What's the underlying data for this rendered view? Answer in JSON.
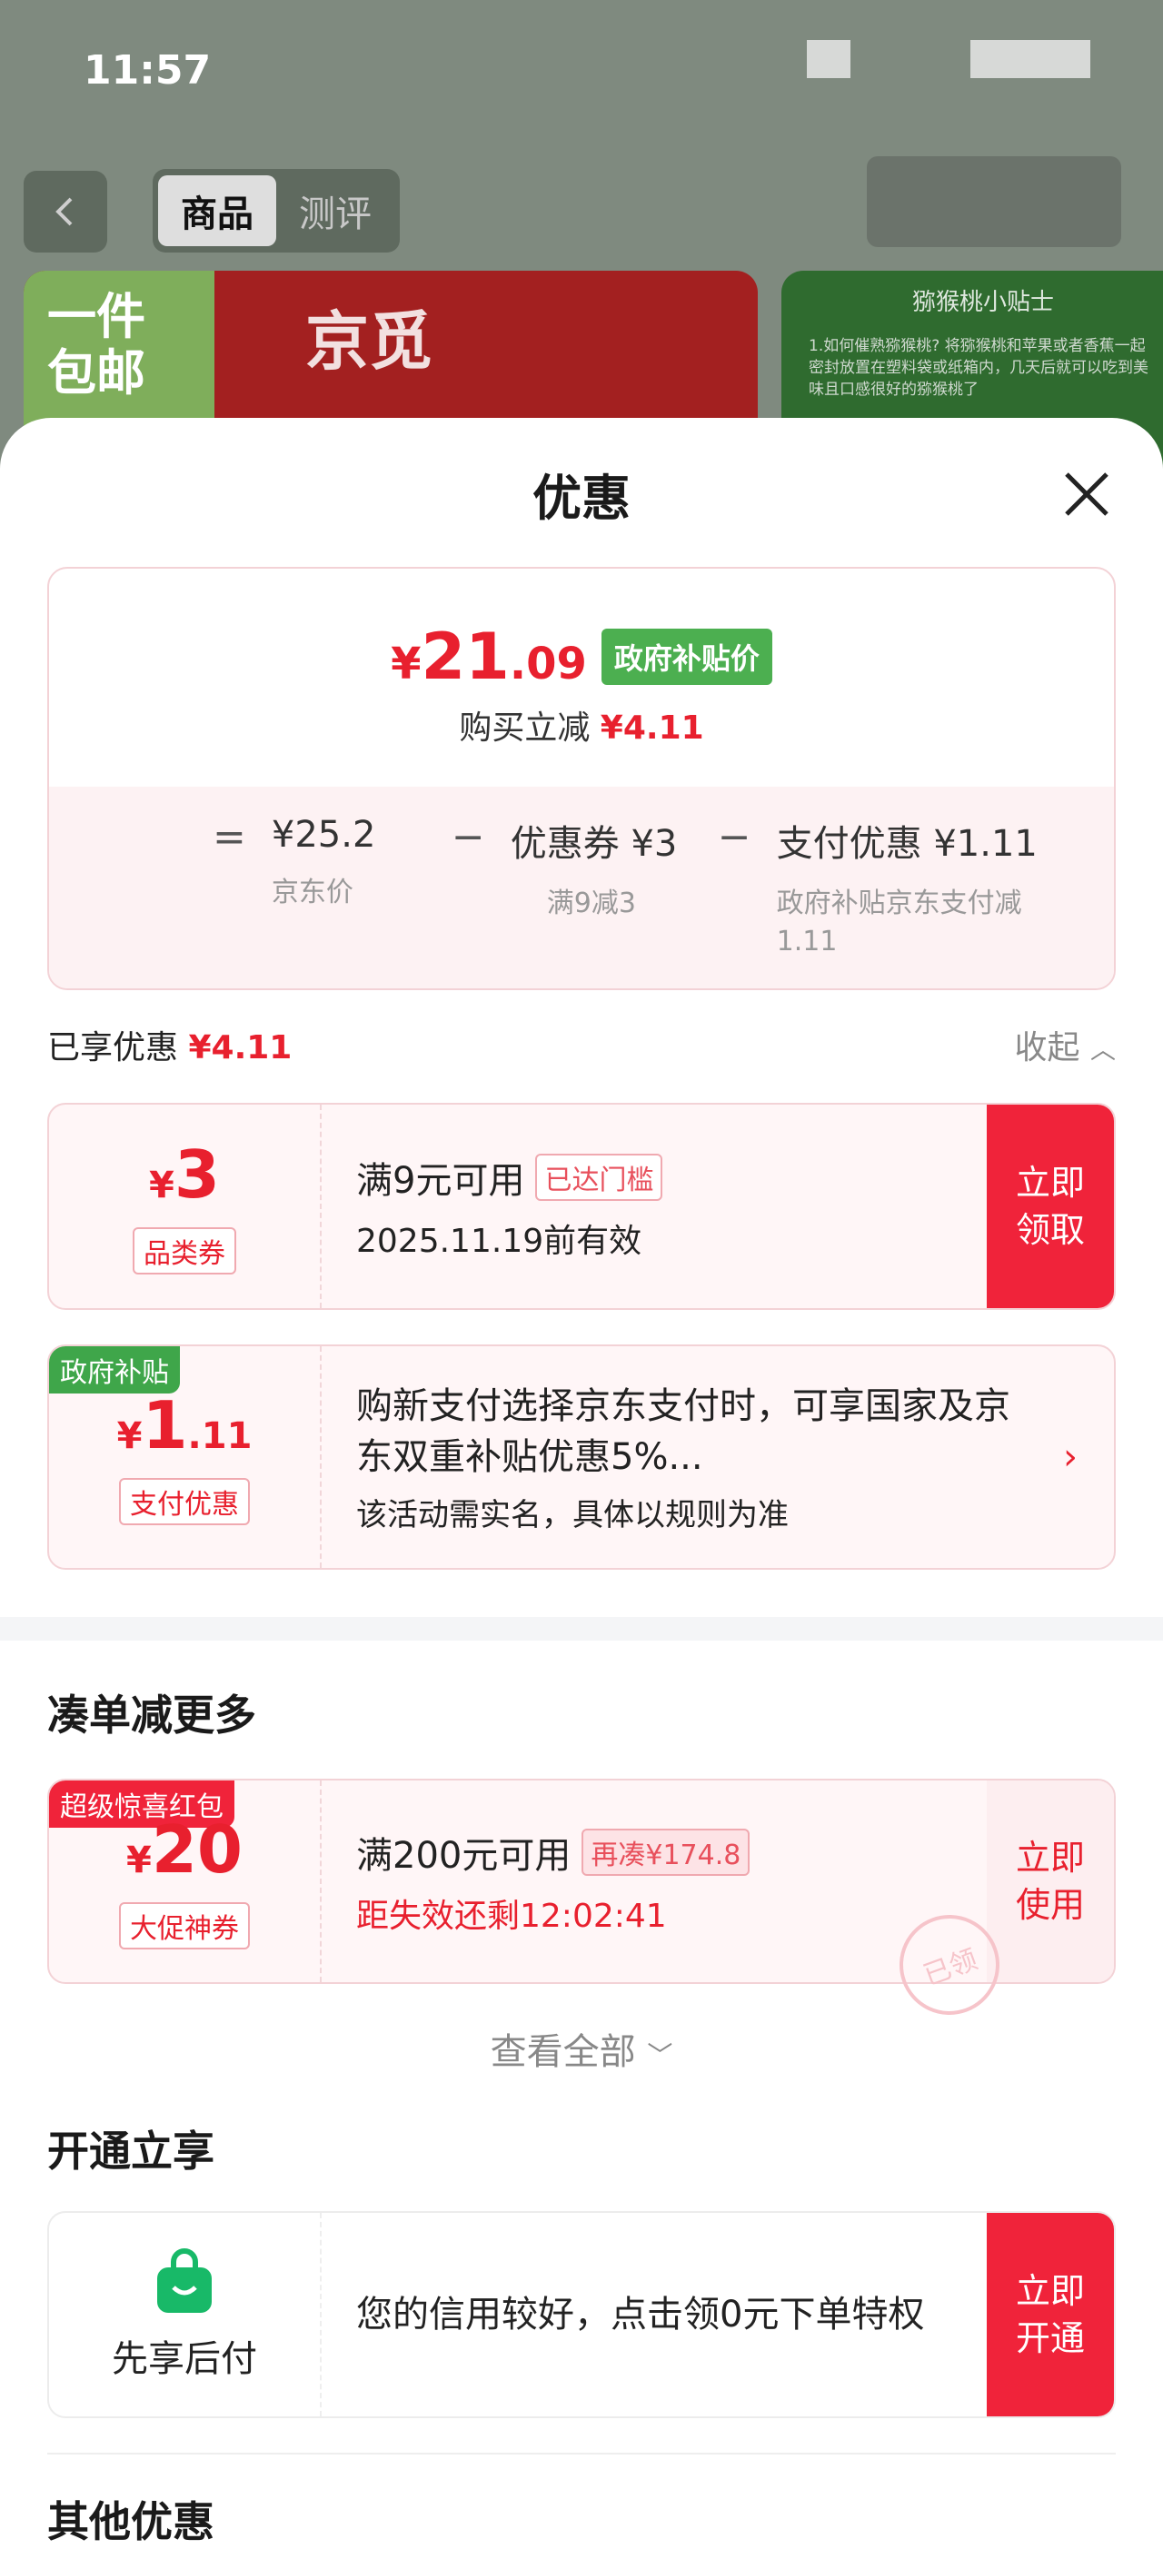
{
  "status_bar": {
    "time": "11:57"
  },
  "header": {
    "tabs": [
      {
        "label": "商品"
      },
      {
        "label": "测评"
      }
    ]
  },
  "background_cards": {
    "left_badge": "一件包邮",
    "left_brand": "京觅",
    "right_title": "猕猴桃小贴士",
    "right_text": "1.如何催熟猕猴桃? 将猕猴桃和苹果或者香蕉一起密封放置在塑料袋或纸箱内，几天后就可以吃到美味且口感很好的猕猴桃了"
  },
  "sheet": {
    "title": "优惠"
  },
  "price_card": {
    "currency": "¥",
    "price_int": "21",
    "price_dec": ".09",
    "tag": "政府补贴价",
    "sub_label": "购买立减",
    "sub_value": "¥4.11",
    "formula": {
      "eq": "=",
      "jd_price": "¥25.2",
      "jd_price_label": "京东价",
      "op1": "−",
      "coupon": "优惠券 ¥3",
      "coupon_label": "满9减3",
      "op2": "−",
      "pay": "支付优惠 ¥1.11",
      "pay_label": "政府补贴京东支付减1.11"
    }
  },
  "enjoyed": {
    "label": "已享优惠",
    "value": "¥4.11",
    "collapse": "收起"
  },
  "coupon1": {
    "currency": "¥",
    "amount": "3",
    "kind": "品类券",
    "condition": "满9元可用",
    "status": "已达门槛",
    "expiry": "2025.11.19前有效",
    "action": "立即领取"
  },
  "coupon2": {
    "corner": "政府补贴",
    "currency": "¥",
    "amount": "1",
    "amount_dec": ".11",
    "kind": "支付优惠",
    "desc": "购新支付选择京东支付时，可享国家及京东双重补贴优惠5%...",
    "note": "该活动需实名，具体以规则为准"
  },
  "section_more": {
    "title": "凑单减更多"
  },
  "coupon3": {
    "corner": "超级惊喜红包",
    "currency": "¥",
    "amount": "20",
    "kind": "大促神券",
    "condition": "满200元可用",
    "status": "再凑¥174.8",
    "countdown": "距失效还剩12:02:41",
    "stamp": "已领",
    "action": "立即使用"
  },
  "view_all": "查看全部",
  "section_open": {
    "title": "开通立享"
  },
  "bnpl": {
    "label": "先享后付",
    "desc": "您的信用较好，点击领0元下单特权",
    "action": "立即开通"
  },
  "section_other": {
    "title": "其他优惠"
  },
  "colors": {
    "accent": "#e8202e",
    "action_red": "#f0233a",
    "gov_green": "#4caf50"
  }
}
